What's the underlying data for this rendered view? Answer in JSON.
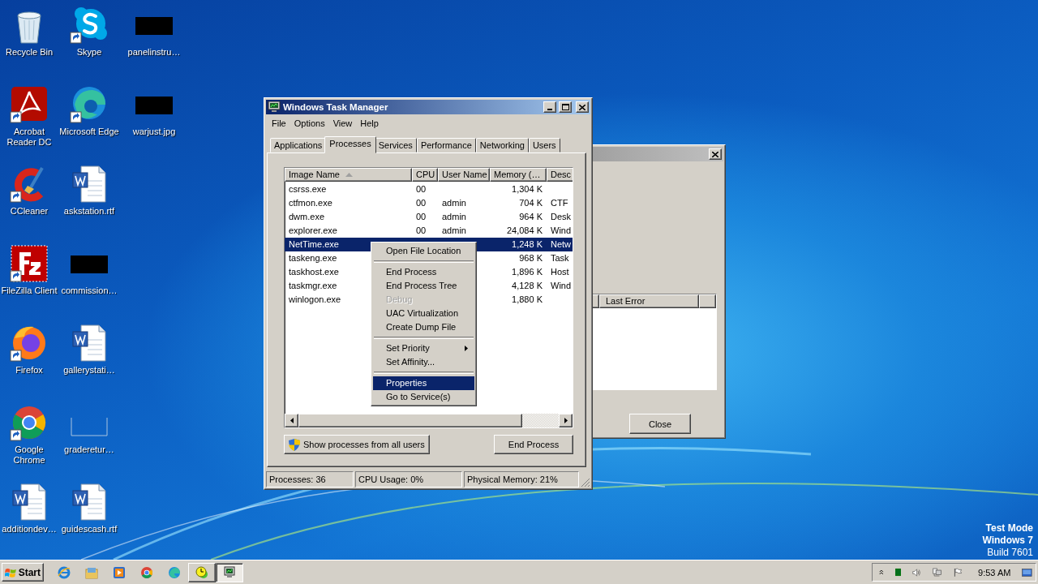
{
  "desktop": {
    "icon_columns": [
      [
        {
          "label": "Recycle Bin",
          "kind": "recycle",
          "shortcut": false
        },
        {
          "label": "Acrobat Reader DC",
          "kind": "acrobat",
          "shortcut": true
        },
        {
          "label": "CCleaner",
          "kind": "ccleaner",
          "shortcut": true
        },
        {
          "label": "FileZilla Client",
          "kind": "filezilla",
          "shortcut": true
        },
        {
          "label": "Firefox",
          "kind": "firefox",
          "shortcut": true
        },
        {
          "label": "Google Chrome",
          "kind": "chrome",
          "shortcut": true
        },
        {
          "label": "additiondev…",
          "kind": "document",
          "shortcut": false
        }
      ],
      [
        {
          "label": "Skype",
          "kind": "skype",
          "shortcut": true
        },
        {
          "label": "Microsoft Edge",
          "kind": "edge",
          "shortcut": true
        },
        {
          "label": "askstation.rtf",
          "kind": "document",
          "shortcut": false
        },
        {
          "label": "commission…",
          "kind": "redacted",
          "shortcut": false
        },
        {
          "label": "gallerystati…",
          "kind": "document",
          "shortcut": false
        },
        {
          "label": "graderetur…",
          "kind": "blank",
          "shortcut": false
        },
        {
          "label": "guidescash.rtf",
          "kind": "document",
          "shortcut": false
        }
      ],
      [
        {
          "label": "panelinstru…",
          "kind": "redacted",
          "shortcut": false
        },
        {
          "label": "warjust.jpg",
          "kind": "redacted",
          "shortcut": false
        }
      ]
    ]
  },
  "system_notice": [
    "Test Mode",
    "Windows 7",
    "Build 7601"
  ],
  "background_dialog": {
    "columns": [
      "Last Error"
    ],
    "buttons": [
      "Close"
    ]
  },
  "task_manager": {
    "title": "Windows Task Manager",
    "menu": [
      "File",
      "Options",
      "View",
      "Help"
    ],
    "tabs": [
      {
        "label": "Applications",
        "selected": false
      },
      {
        "label": "Processes",
        "selected": true
      },
      {
        "label": "Services",
        "selected": false
      },
      {
        "label": "Performance",
        "selected": false
      },
      {
        "label": "Networking",
        "selected": false
      },
      {
        "label": "Users",
        "selected": false
      }
    ],
    "table": {
      "columns": [
        {
          "label": "Image Name",
          "sorted": true
        },
        {
          "label": "CPU",
          "sorted": false
        },
        {
          "label": "User Name",
          "sorted": false
        },
        {
          "label": "Memory (…",
          "sorted": false
        },
        {
          "label": "Desc",
          "sorted": false
        }
      ],
      "rows": [
        {
          "name": "csrss.exe",
          "cpu": "00",
          "memory": "1,304 K",
          "selected": false
        },
        {
          "name": "ctfmon.exe",
          "cpu": "00",
          "user": "admin",
          "memory": "704 K",
          "desc": "CTF",
          "selected": false
        },
        {
          "name": "dwm.exe",
          "cpu": "00",
          "user": "admin",
          "memory": "964 K",
          "desc": "Desk",
          "selected": false
        },
        {
          "name": "explorer.exe",
          "cpu": "00",
          "user": "admin",
          "memory": "24,084 K",
          "desc": "Wind",
          "selected": false
        },
        {
          "name": "NetTime.exe",
          "memory": "1,248 K",
          "desc": "Netw",
          "selected": true
        },
        {
          "name": "taskeng.exe",
          "memory": "968 K",
          "desc": "Task",
          "selected": false
        },
        {
          "name": "taskhost.exe",
          "memory": "1,896 K",
          "desc": "Host",
          "selected": false
        },
        {
          "name": "taskmgr.exe",
          "memory": "4,128 K",
          "desc": "Wind",
          "selected": false
        },
        {
          "name": "winlogon.exe",
          "memory": "1,880 K",
          "selected": false
        }
      ]
    },
    "buttons": [
      {
        "label": "Show processes from all users",
        "shield": true
      },
      {
        "label": "End Process",
        "shield": false
      }
    ],
    "status_bar": [
      "Processes: 36",
      "CPU Usage: 0%",
      "Physical Memory: 21%"
    ]
  },
  "context_menu": {
    "items": [
      {
        "kind": "item",
        "label": "Open File Location",
        "disabled": false,
        "selected": false,
        "submenu": false
      },
      {
        "kind": "separator"
      },
      {
        "kind": "item",
        "label": "End Process",
        "disabled": false,
        "selected": false,
        "submenu": false
      },
      {
        "kind": "item",
        "label": "End Process Tree",
        "disabled": false,
        "selected": false,
        "submenu": false
      },
      {
        "kind": "item",
        "label": "Debug",
        "disabled": true,
        "selected": false,
        "submenu": false
      },
      {
        "kind": "item",
        "label": "UAC Virtualization",
        "disabled": false,
        "selected": false,
        "submenu": false
      },
      {
        "kind": "item",
        "label": "Create Dump File",
        "disabled": false,
        "selected": false,
        "submenu": false
      },
      {
        "kind": "separator"
      },
      {
        "kind": "item",
        "label": "Set Priority",
        "disabled": false,
        "selected": false,
        "submenu": true
      },
      {
        "kind": "item",
        "label": "Set Affinity...",
        "disabled": false,
        "selected": false,
        "submenu": false
      },
      {
        "kind": "separator"
      },
      {
        "kind": "item",
        "label": "Properties",
        "disabled": false,
        "selected": true,
        "submenu": false
      },
      {
        "kind": "item",
        "label": "Go to Service(s)",
        "disabled": false,
        "selected": false,
        "submenu": false
      }
    ]
  },
  "taskbar": {
    "start": "Start",
    "apps": [
      {
        "kind": "ie",
        "running": false,
        "active": false
      },
      {
        "kind": "explorer",
        "running": false,
        "active": false
      },
      {
        "kind": "media",
        "running": false,
        "active": false
      },
      {
        "kind": "chrome",
        "running": false,
        "active": false
      },
      {
        "kind": "edge",
        "running": false,
        "active": false
      },
      {
        "kind": "clock",
        "running": true,
        "active": false
      },
      {
        "kind": "taskmgr",
        "running": true,
        "active": true
      }
    ],
    "tray": {
      "time": "9:53 AM"
    }
  }
}
